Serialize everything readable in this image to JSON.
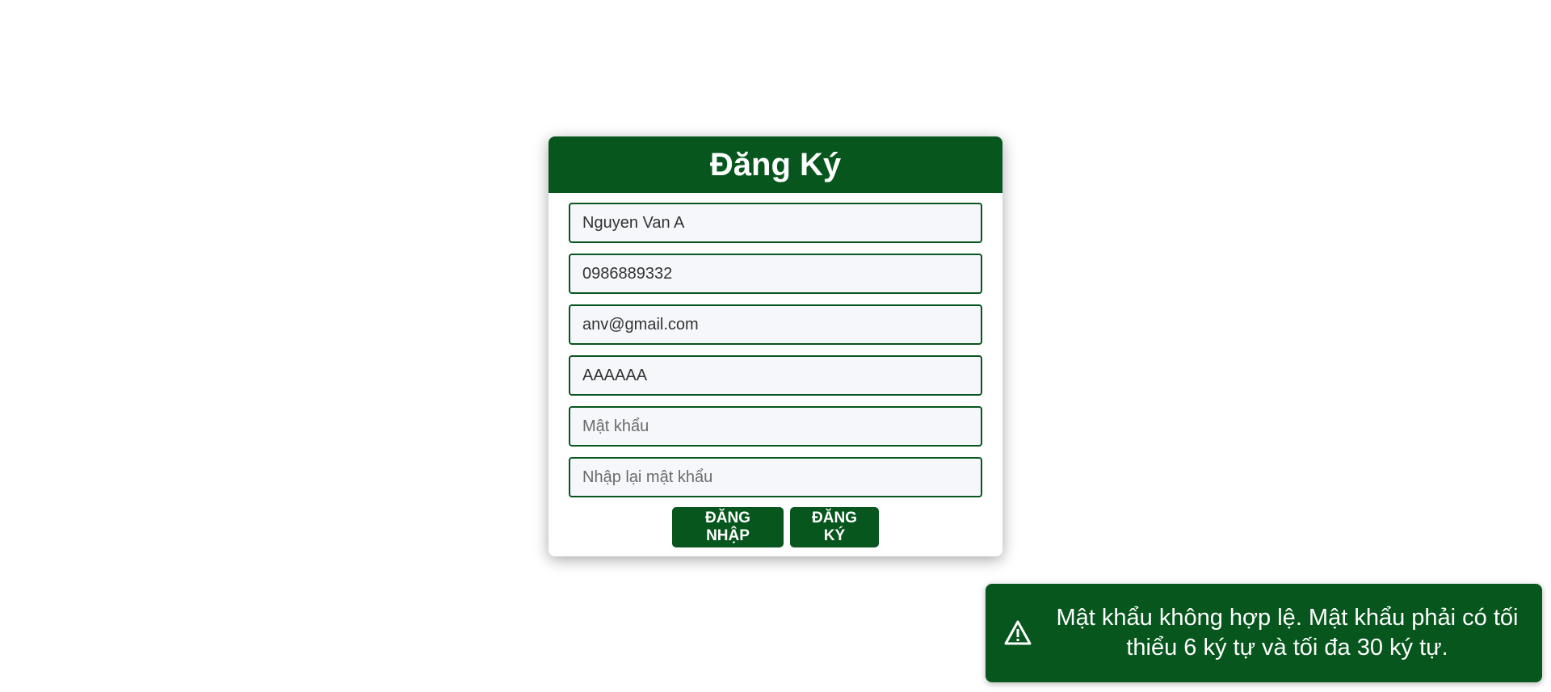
{
  "register_form": {
    "title": "Đăng Ký",
    "fields": {
      "full_name": {
        "value": "Nguyen Van A",
        "placeholder": ""
      },
      "phone": {
        "value": "0986889332",
        "placeholder": ""
      },
      "email": {
        "value": "anv@gmail.com",
        "placeholder": ""
      },
      "username": {
        "value": "AAAAAA",
        "placeholder": ""
      },
      "password": {
        "value": "",
        "placeholder": "Mật khẩu"
      },
      "confirm_password": {
        "value": "",
        "placeholder": "Nhập lại mật khẩu"
      }
    },
    "buttons": {
      "login_label": "ĐĂNG NHẬP",
      "register_label": "ĐĂNG KÝ"
    }
  },
  "toast": {
    "icon": "warning-icon",
    "message": "Mật khẩu không hợp lệ. Mật khẩu phải có tối thiểu 6 ký tự và tối đa 30 ký tự."
  },
  "colors": {
    "primary_green": "#07561d",
    "input_background": "#f5f7fa",
    "page_background": "#ffffff"
  }
}
